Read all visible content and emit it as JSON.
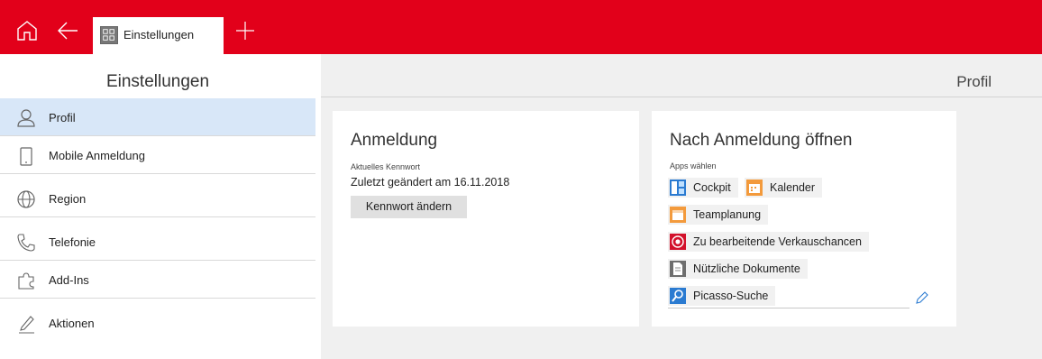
{
  "topbar": {
    "tab_label": "Einstellungen",
    "brand_color": "#e2001a"
  },
  "sidebar": {
    "title": "Einstellungen",
    "items": [
      {
        "label": "Profil",
        "icon": "person-icon",
        "active": true
      },
      {
        "label": "Mobile Anmeldung",
        "icon": "phone-device-icon",
        "active": false
      },
      {
        "label": "Region",
        "icon": "globe-icon",
        "active": false
      },
      {
        "label": "Telefonie",
        "icon": "telephone-icon",
        "active": false
      },
      {
        "label": "Add-Ins",
        "icon": "puzzle-icon",
        "active": false
      },
      {
        "label": "Aktionen",
        "icon": "pen-icon",
        "active": false
      }
    ]
  },
  "main": {
    "page_title": "Profil",
    "login_card": {
      "title": "Anmeldung",
      "password_label": "Aktuelles Kennwort",
      "password_status": "Zuletzt geändert am 16.11.2018",
      "change_button": "Kennwort ändern"
    },
    "open_card": {
      "title": "Nach Anmeldung öffnen",
      "apps_label": "Apps wählen",
      "apps": [
        {
          "label": "Cockpit",
          "icon": "cockpit-icon",
          "color": "#2b7bd1"
        },
        {
          "label": "Kalender",
          "icon": "calendar-icon",
          "color": "#f39a3c"
        },
        {
          "label": "Teamplanung",
          "icon": "team-calendar-icon",
          "color": "#f39a3c"
        },
        {
          "label": "Zu bearbeitende Verkauschancen",
          "icon": "target-icon",
          "color": "#d3112b"
        },
        {
          "label": "Nützliche Dokumente",
          "icon": "document-icon",
          "color": "#6e6e6e"
        },
        {
          "label": "Picasso-Suche",
          "icon": "search-icon",
          "color": "#2b7bd1"
        }
      ]
    }
  }
}
